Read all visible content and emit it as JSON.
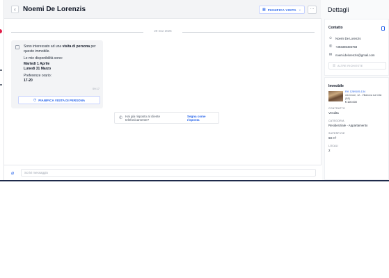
{
  "header": {
    "back_icon": "chevron-left-icon",
    "title": "Noemi De Lorenzis",
    "plan_visit_label": "PIANIFICA VISITA",
    "more_label": "···"
  },
  "conversation": {
    "date_separator": "29 mar 2025",
    "message": {
      "line1_prefix": "Sono interessato ad una ",
      "line1_bold": "visita di persona",
      "line1_suffix": " per questo immobile.",
      "availability_intro": "Le mie disponibilità sono:",
      "day1": "Martedì 1 Aprile",
      "day2": "Lunedì 31 Marzo",
      "time_pref_label": "Preferenze orario:",
      "time_pref_value": "17-20",
      "time": "09:17",
      "visit_button_label": "PIANIFICA VISITA DI PERSONA"
    },
    "call_prompt": {
      "text": "Hai già risposto al cliente telefonicamente?",
      "link": "Segna come risposta"
    },
    "composer": {
      "placeholder": "Scrivi messaggio"
    }
  },
  "details": {
    "title": "Dettagli",
    "contact": {
      "section_title": "Contatto",
      "name": "Noemi De Lorenzis",
      "phone": "+393386493758",
      "email": "noemi.delorenzis@gmail.com",
      "other_requests_label": "ALTRE RICHIESTE"
    },
    "property": {
      "section_title": "Immobile",
      "ref": "Rif. 1289105-134",
      "address": "via Croce, 12 - Villanova sul Clisi (BS)",
      "price": "€ 100.000",
      "contract_label": "CONTRATTO",
      "contract_value": "Vendita",
      "category_label": "CATEGORIA",
      "category_value": "Residenziale - Appartamento",
      "surface_label": "SUPERFICIE",
      "surface_value": "68 m²",
      "rooms_label": "LOCALI",
      "rooms_value": "2"
    }
  },
  "colors": {
    "accent": "#2563eb",
    "header_bg": "#f3f4f6",
    "bubble_bg": "#f3f4f6",
    "notification_dot": "#e11d48",
    "bottom_bar": "#1e2a4a"
  }
}
